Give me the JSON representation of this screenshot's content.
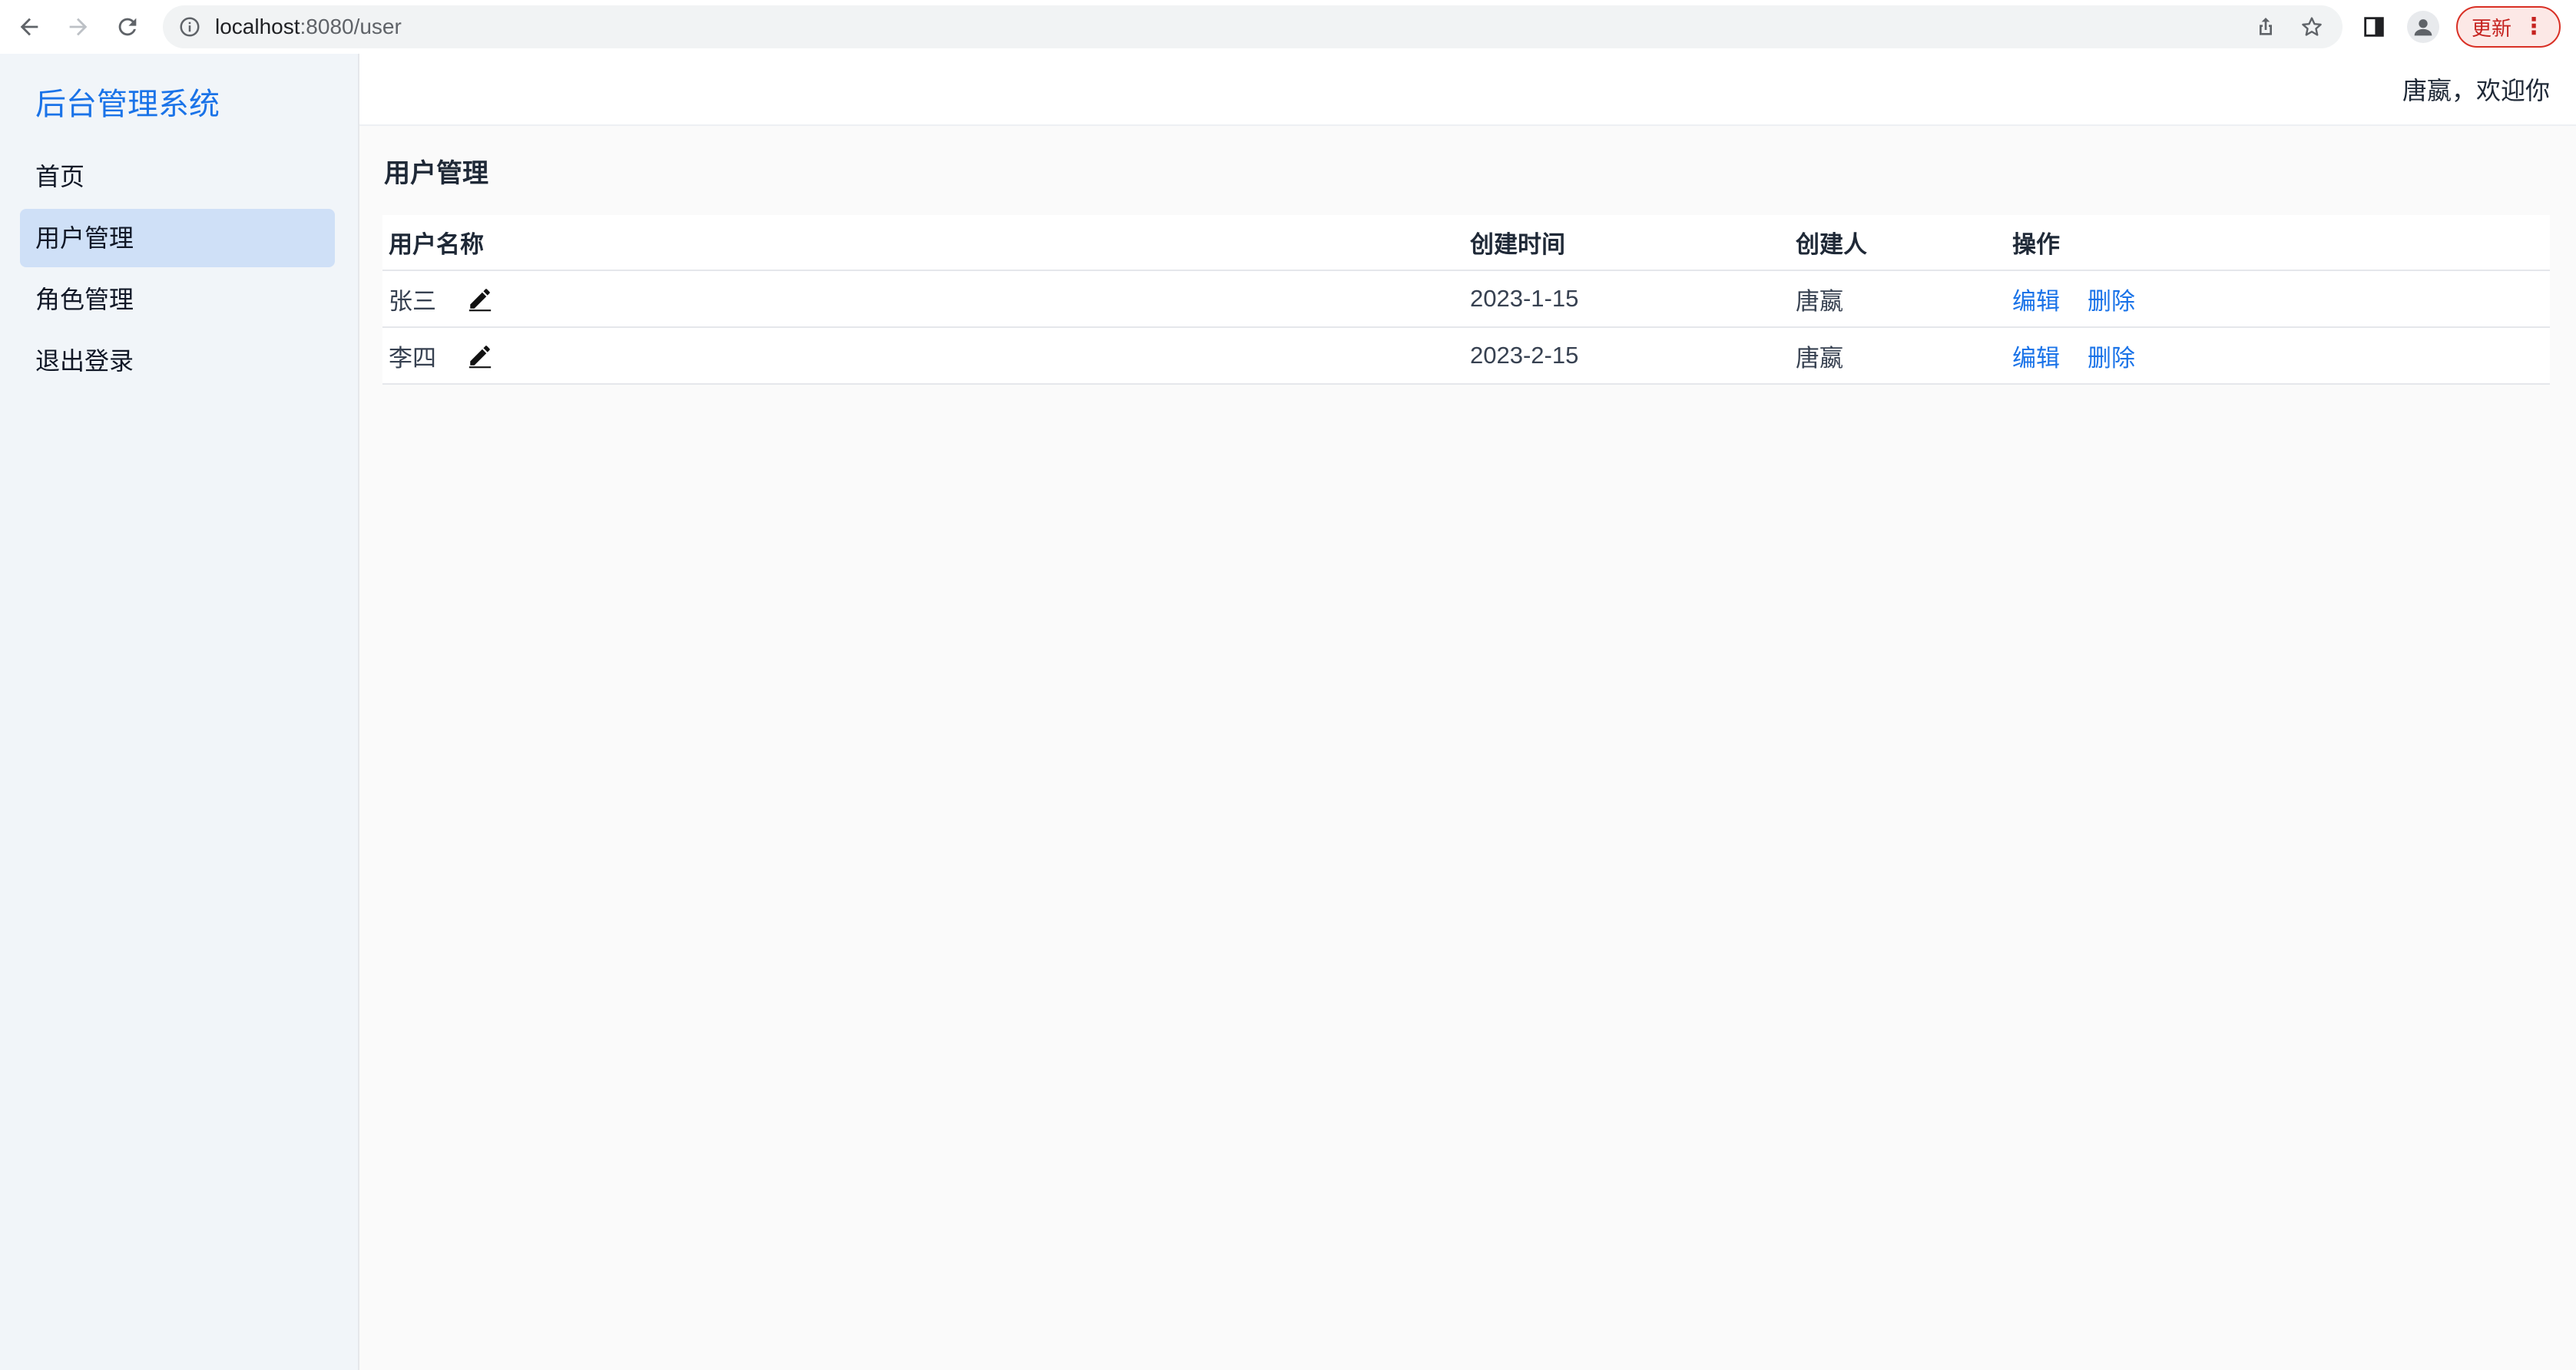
{
  "browser": {
    "url_host": "localhost",
    "url_path": ":8080/user",
    "update_label": "更新",
    "icons": [
      "back-arrow-icon",
      "forward-arrow-icon",
      "reload-icon",
      "info-icon",
      "share-icon",
      "star-icon",
      "side-panel-icon",
      "profile-icon",
      "kebab-menu-icon"
    ]
  },
  "sidebar": {
    "brand": "后台管理系统",
    "items": [
      {
        "label": "首页",
        "active": false
      },
      {
        "label": "用户管理",
        "active": true
      },
      {
        "label": "角色管理",
        "active": false
      },
      {
        "label": "退出登录",
        "active": false
      }
    ]
  },
  "header": {
    "welcome": "唐嬴，欢迎你"
  },
  "main": {
    "title": "用户管理",
    "table": {
      "columns": [
        "用户名称",
        "创建时间",
        "创建人",
        "操作"
      ],
      "rows": [
        {
          "name": "张三",
          "created_at": "2023-1-15",
          "creator": "唐嬴",
          "edit": "编辑",
          "delete": "删除"
        },
        {
          "name": "李四",
          "created_at": "2023-2-15",
          "creator": "唐嬴",
          "edit": "编辑",
          "delete": "删除"
        }
      ]
    }
  },
  "colors": {
    "accent": "#1a73e8",
    "sidebar_bg": "#f1f5f9",
    "active_item_bg": "#cfe0f7",
    "update_red": "#d93025"
  }
}
